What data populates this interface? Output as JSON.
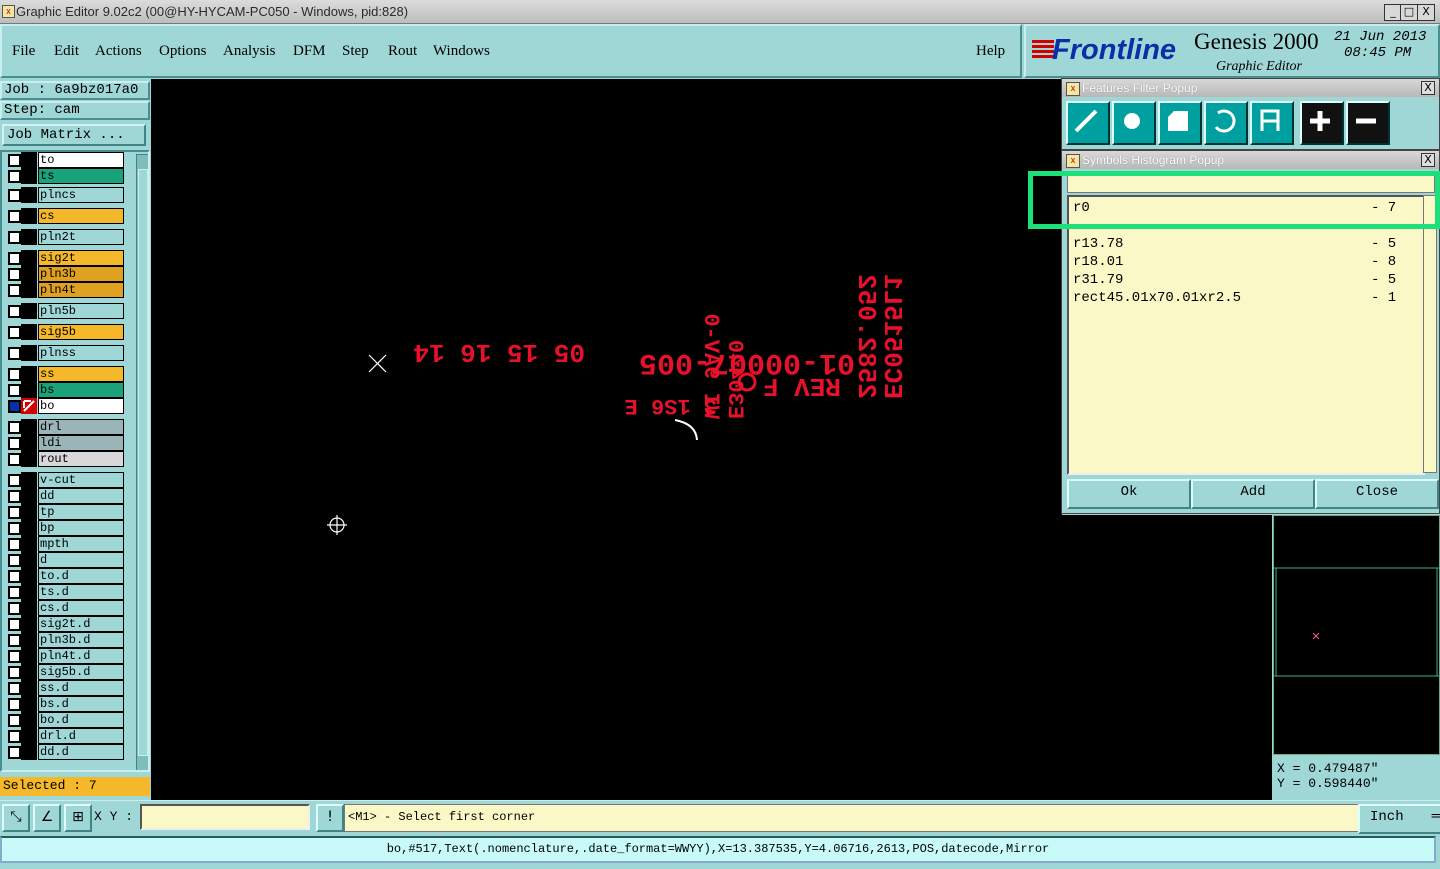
{
  "window": {
    "title": "Graphic Editor 9.02c2 (00@HY-HYCAM-PC050 - Windows, pid:828)",
    "minimize": "_",
    "maximize": "□",
    "close": "X"
  },
  "menu": {
    "items": [
      "File",
      "Edit",
      "Actions",
      "Options",
      "Analysis",
      "DFM",
      "Step",
      "Rout",
      "Windows"
    ],
    "help": "Help"
  },
  "logo": {
    "brand": "Frontline",
    "product": "Genesis 2000",
    "subtitle": "Graphic Editor",
    "date": "21 Jun 2013",
    "time": "08:45 PM"
  },
  "job": {
    "job_label": "Job : 6a9bz017a0",
    "step_label": "Step: cam",
    "matrix_button": "Job Matrix ..."
  },
  "layers": [
    {
      "name": "to",
      "color": "#ffffff"
    },
    {
      "name": "ts",
      "color": "#1aa37a"
    },
    {
      "name": "plncs",
      "color": "#9fd6d6"
    },
    {
      "name": "cs",
      "color": "#f5b82a"
    },
    {
      "name": "pln2t",
      "color": "#9fd6d6"
    },
    {
      "name": "sig2t",
      "color": "#f5b82a"
    },
    {
      "name": "pln3b",
      "color": "#e0a020"
    },
    {
      "name": "pln4t",
      "color": "#e0a020"
    },
    {
      "name": "pln5b",
      "color": "#9fd6d6"
    },
    {
      "name": "sig5b",
      "color": "#f5b82a"
    },
    {
      "name": "plnss",
      "color": "#9fd6d6"
    },
    {
      "name": "ss",
      "color": "#f5b82a"
    },
    {
      "name": "bs",
      "color": "#1aa37a"
    },
    {
      "name": "bo",
      "color": "#ffffff"
    },
    {
      "name": "drl",
      "color": "#9ab4b8"
    },
    {
      "name": "ldi",
      "color": "#9ab4b8"
    },
    {
      "name": "rout",
      "color": "#d8d8d8"
    },
    {
      "name": "v-cut",
      "color": "#9fd6d6"
    },
    {
      "name": "dd",
      "color": "#9fd6d6"
    },
    {
      "name": "tp",
      "color": "#9fd6d6"
    },
    {
      "name": "bp",
      "color": "#9fd6d6"
    },
    {
      "name": "mpth",
      "color": "#9fd6d6"
    },
    {
      "name": "d",
      "color": "#9fd6d6"
    },
    {
      "name": "to.d",
      "color": "#9fd6d6"
    },
    {
      "name": "ts.d",
      "color": "#9fd6d6"
    },
    {
      "name": "cs.d",
      "color": "#9fd6d6"
    },
    {
      "name": "sig2t.d",
      "color": "#9fd6d6"
    },
    {
      "name": "pln3b.d",
      "color": "#9fd6d6"
    },
    {
      "name": "pln4t.d",
      "color": "#9fd6d6"
    },
    {
      "name": "sig5b.d",
      "color": "#9fd6d6"
    },
    {
      "name": "ss.d",
      "color": "#9fd6d6"
    },
    {
      "name": "bs.d",
      "color": "#9fd6d6"
    },
    {
      "name": "bo.d",
      "color": "#9fd6d6"
    },
    {
      "name": "drl.d",
      "color": "#9fd6d6"
    },
    {
      "name": "dd.d",
      "color": "#9fd6d6"
    }
  ],
  "selected": "Selected : 7",
  "canvas_text": {
    "line1": "01-00007-005",
    "line2": "REV F",
    "line3": "05 15 16 14",
    "line4": "3 1S6 E",
    "line5": "WI 9AV-0",
    "line6": "E30440",
    "line7": "2582.052",
    "line8": "EC0515L1"
  },
  "features_filter": {
    "title": "Features Filter Popup",
    "close": "X"
  },
  "histogram": {
    "title": "Symbols Histogram Popup",
    "close": "X",
    "rows": [
      {
        "sym": "r0",
        "count": "- 7"
      },
      {
        "sym": "r13.78",
        "count": "- 5"
      },
      {
        "sym": "r18.01",
        "count": "- 8"
      },
      {
        "sym": "r31.79",
        "count": "- 5"
      },
      {
        "sym": "rect45.01x70.01xr2.5",
        "count": "- 1"
      }
    ],
    "ok": "Ok",
    "add": "Add",
    "close_btn": "Close"
  },
  "coords": {
    "x": "X = 0.479487\"",
    "y": "Y = 0.598440\""
  },
  "bottom": {
    "xy_label": "X Y :",
    "xy_value": "",
    "alert": "!",
    "prompt": "<M1> - Select first corner",
    "unit": "Inch"
  },
  "status": "bo,#517,Text(.nomenclature,.date_format=WWYY),X=13.387535,Y=4.06716,2613,POS,datecode,Mirror"
}
